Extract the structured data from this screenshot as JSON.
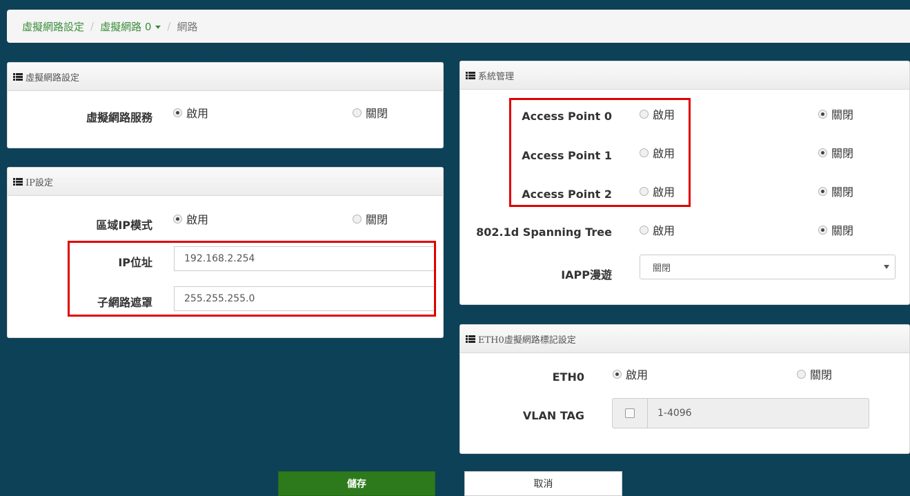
{
  "breadcrumb": {
    "item1": "虛擬網路設定",
    "item2": "虛擬網路 0",
    "current": "網路",
    "sep": "/"
  },
  "vlan_panel": {
    "title": "虛擬網路設定",
    "service_label": "虛擬網路服務",
    "enable": "啟用",
    "disable": "關閉",
    "selected": "enable"
  },
  "ip_panel": {
    "title": "IP設定",
    "mode_label": "區域IP模式",
    "enable": "啟用",
    "disable": "關閉",
    "selected": "enable",
    "ip_label": "IP位址",
    "ip_value": "192.168.2.254",
    "mask_label": "子網路遮罩",
    "mask_value": "255.255.255.0"
  },
  "sys_panel": {
    "title": "系統管理",
    "ap0_label": "Access Point 0",
    "ap1_label": "Access Point 1",
    "ap2_label": "Access Point 2",
    "stp_label": "802.1d Spanning Tree",
    "enable": "啟用",
    "disable": "關閉",
    "ap0_selected": "disable",
    "ap1_selected": "disable",
    "ap2_selected": "disable",
    "stp_selected": "disable",
    "iapp_label": "IAPP漫遊",
    "iapp_value": "關閉"
  },
  "eth_panel": {
    "title": "ETH0虛擬網路標記設定",
    "eth_label": "ETH0",
    "enable": "啟用",
    "disable": "關閉",
    "selected": "enable",
    "vlan_label": "VLAN TAG",
    "vlan_placeholder": "1-4096",
    "vlan_checked": false
  },
  "buttons": {
    "save": "儲存",
    "cancel": "取消"
  },
  "colors": {
    "background": "#0d4158",
    "save_button": "#2d7a1c",
    "highlight": "#e00000",
    "link": "#3c8d3c"
  }
}
